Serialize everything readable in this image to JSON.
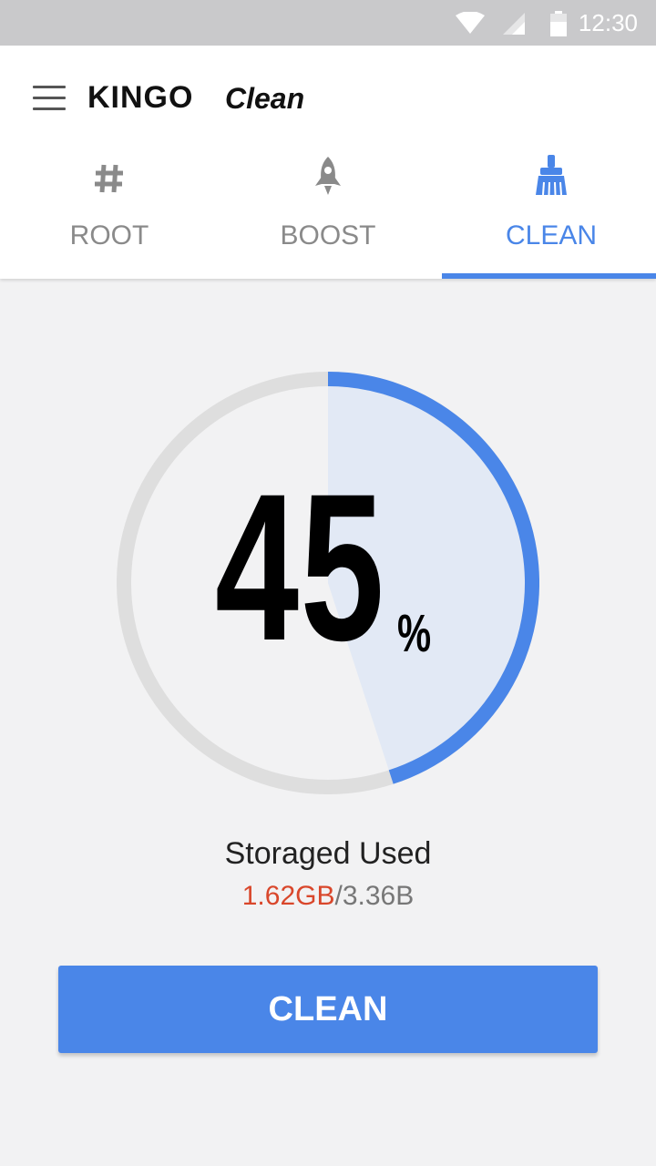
{
  "status_bar": {
    "time": "12:30",
    "wifi_icon": "wifi-icon",
    "signal_icon": "signal-icon",
    "battery_icon": "battery-icon"
  },
  "header": {
    "brand": "KINGO",
    "brand_sub": "Clean",
    "menu_icon": "menu-icon"
  },
  "tabs": [
    {
      "label": "ROOT",
      "icon": "hash-icon",
      "active": false
    },
    {
      "label": "BOOST",
      "icon": "rocket-icon",
      "active": false
    },
    {
      "label": "CLEAN",
      "icon": "broom-icon",
      "active": true
    }
  ],
  "gauge": {
    "percent_value": 45,
    "percent_text": "45",
    "percent_sign": "%"
  },
  "storage": {
    "label": "Storaged Used",
    "used": "1.62GB",
    "separator": "/",
    "total": "3.36B"
  },
  "actions": {
    "clean_label": "CLEAN"
  },
  "colors": {
    "accent": "#4a86e8",
    "used": "#d9472b",
    "track": "#dedede",
    "fill": "#e2e9f5"
  }
}
